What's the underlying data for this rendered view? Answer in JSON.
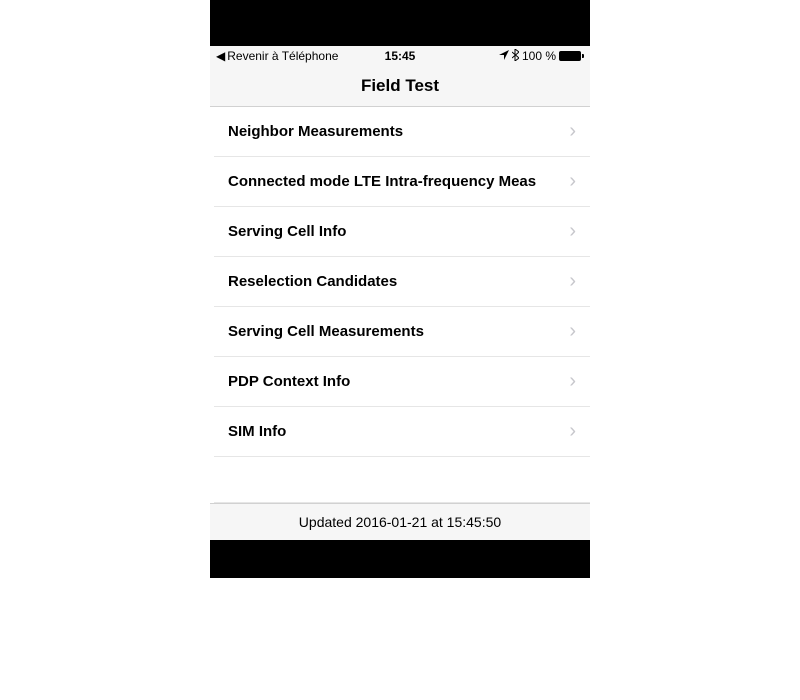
{
  "statusBar": {
    "backText": "Revenir à Téléphone",
    "time": "15:45",
    "batteryText": "100 %"
  },
  "header": {
    "title": "Field Test"
  },
  "list": {
    "items": [
      {
        "label": "Neighbor Measurements"
      },
      {
        "label": "Connected mode LTE Intra-frequency Meas"
      },
      {
        "label": "Serving Cell Info"
      },
      {
        "label": "Reselection Candidates"
      },
      {
        "label": "Serving Cell Measurements"
      },
      {
        "label": "PDP Context Info"
      },
      {
        "label": "SIM Info"
      }
    ]
  },
  "footer": {
    "text": "Updated 2016-01-21 at 15:45:50"
  }
}
